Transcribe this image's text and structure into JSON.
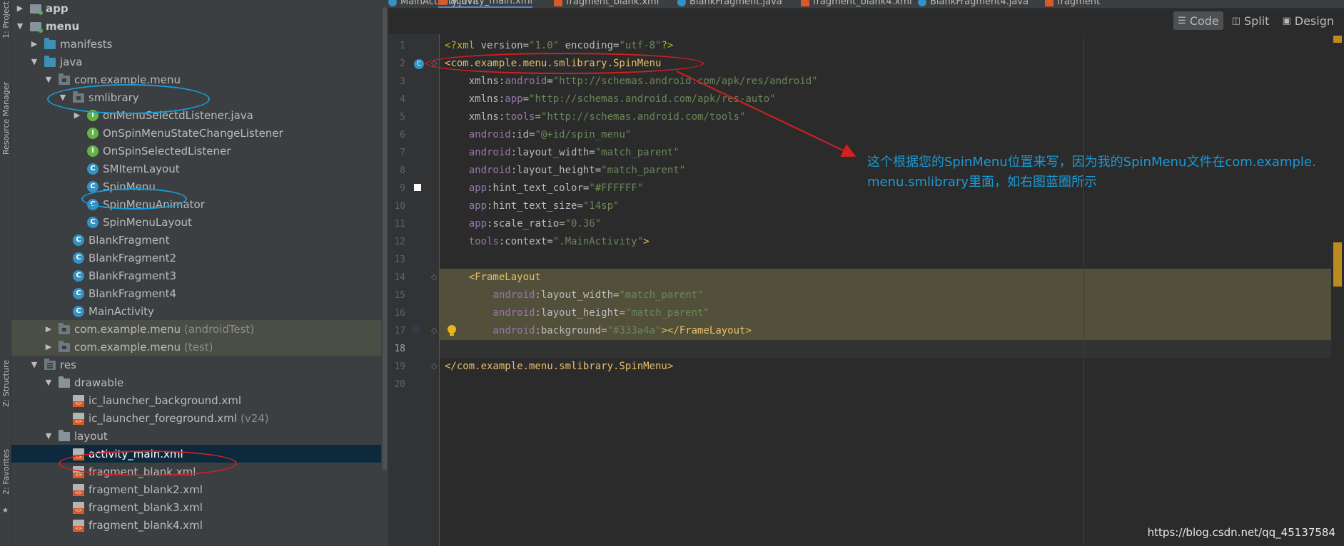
{
  "tool_strip": {
    "project_label": "1: Project",
    "resource_manager_label": "Resource Manager",
    "structure_label": "Z: Structure",
    "favorites_label": "2: Favorites"
  },
  "project_tree": {
    "items": [
      {
        "label": "app",
        "arrow": "▶",
        "icon": "module-folder-icon",
        "bold": true
      },
      {
        "label": "menu",
        "arrow": "▼",
        "icon": "module-folder-icon",
        "bold": true
      },
      {
        "label": "manifests",
        "arrow": "▶",
        "icon": "folder-icon"
      },
      {
        "label": "java",
        "arrow": "▼",
        "icon": "folder-icon"
      },
      {
        "label": "com.example.menu",
        "arrow": "▼",
        "icon": "package-icon"
      },
      {
        "label": "smlibrary",
        "arrow": "▼",
        "icon": "package-icon"
      },
      {
        "label": "onMenuSelectdListener.java",
        "arrow": "▶",
        "icon": "interface-icon",
        "glyph": "I"
      },
      {
        "label": "OnSpinMenuStateChangeListener",
        "icon": "interface-icon",
        "glyph": "I"
      },
      {
        "label": "OnSpinSelectedListener",
        "icon": "interface-icon",
        "glyph": "I"
      },
      {
        "label": "SMItemLayout",
        "icon": "class-icon",
        "glyph": "C"
      },
      {
        "label": "SpinMenu",
        "icon": "class-icon",
        "glyph": "C"
      },
      {
        "label": "SpinMenuAnimator",
        "icon": "class-icon",
        "glyph": "C"
      },
      {
        "label": "SpinMenuLayout",
        "icon": "class-icon",
        "glyph": "C"
      },
      {
        "label": "BlankFragment",
        "icon": "class-icon",
        "glyph": "C"
      },
      {
        "label": "BlankFragment2",
        "icon": "class-icon",
        "glyph": "C"
      },
      {
        "label": "BlankFragment3",
        "icon": "class-icon",
        "glyph": "C"
      },
      {
        "label": "BlankFragment4",
        "icon": "class-icon",
        "glyph": "C"
      },
      {
        "label": "MainActivity",
        "icon": "class-icon",
        "glyph": "C"
      },
      {
        "label": "com.example.menu",
        "suffix": "(androidTest)",
        "arrow": "▶",
        "icon": "package-icon"
      },
      {
        "label": "com.example.menu",
        "suffix": "(test)",
        "arrow": "▶",
        "icon": "package-icon"
      },
      {
        "label": "res",
        "arrow": "▼",
        "icon": "res-folder-icon"
      },
      {
        "label": "drawable",
        "arrow": "▼",
        "icon": "folder-icon"
      },
      {
        "label": "ic_launcher_background.xml",
        "icon": "xml-file-icon"
      },
      {
        "label": "ic_launcher_foreground.xml",
        "suffix": "(v24)",
        "icon": "xml-file-icon"
      },
      {
        "label": "layout",
        "arrow": "▼",
        "icon": "folder-icon"
      },
      {
        "label": "activity_main.xml",
        "icon": "xml-file-icon"
      },
      {
        "label": "fragment_blank.xml",
        "icon": "xml-file-icon"
      },
      {
        "label": "fragment_blank2.xml",
        "icon": "xml-file-icon"
      },
      {
        "label": "fragment_blank3.xml",
        "icon": "xml-file-icon"
      },
      {
        "label": "fragment_blank4.xml",
        "icon": "xml-file-icon"
      }
    ]
  },
  "editor_tabs": [
    {
      "label": "MainActivity.java",
      "icon": "java-class-icon"
    },
    {
      "label": "activity_main.xml",
      "icon": "xml-file-icon",
      "active": true
    },
    {
      "label": "fragment_blank.xml",
      "icon": "xml-file-icon"
    },
    {
      "label": "BlankFragment.java",
      "icon": "java-class-icon"
    },
    {
      "label": "fragment_blank4.xml",
      "icon": "xml-file-icon"
    },
    {
      "label": "BlankFragment4.java",
      "icon": "java-class-icon"
    },
    {
      "label": "fragment",
      "icon": "xml-file-icon"
    }
  ],
  "view_mode": {
    "code": "Code",
    "split": "Split",
    "design": "Design"
  },
  "code_lines": [
    [
      [
        "t-decl",
        "<?xml "
      ],
      [
        "t-attr",
        "version="
      ],
      [
        "t-val",
        "\"1.0\""
      ],
      [
        "t-attr",
        " encoding="
      ],
      [
        "t-val",
        "\"utf-8\""
      ],
      [
        "t-decl",
        "?>"
      ]
    ],
    [
      [
        "t-tag",
        "<com.example.menu.smlibrary.SpinMenu"
      ]
    ],
    [
      [
        "t-plain",
        "    "
      ],
      [
        "t-attr",
        "xmlns:"
      ],
      [
        "t-ns",
        "android"
      ],
      [
        "t-attr",
        "="
      ],
      [
        "t-val",
        "\"http://schemas.android.com/apk/res/android\""
      ]
    ],
    [
      [
        "t-plain",
        "    "
      ],
      [
        "t-attr",
        "xmlns:"
      ],
      [
        "t-ns",
        "app"
      ],
      [
        "t-attr",
        "="
      ],
      [
        "t-val",
        "\"http://schemas.android.com/apk/res-auto\""
      ]
    ],
    [
      [
        "t-plain",
        "    "
      ],
      [
        "t-attr",
        "xmlns:"
      ],
      [
        "t-ns",
        "tools"
      ],
      [
        "t-attr",
        "="
      ],
      [
        "t-val",
        "\"http://schemas.android.com/tools\""
      ]
    ],
    [
      [
        "t-plain",
        "    "
      ],
      [
        "t-ns",
        "android"
      ],
      [
        "t-attr",
        ":id="
      ],
      [
        "t-val",
        "\"@+id/spin_menu\""
      ]
    ],
    [
      [
        "t-plain",
        "    "
      ],
      [
        "t-ns",
        "android"
      ],
      [
        "t-attr",
        ":layout_width="
      ],
      [
        "t-val",
        "\"match_parent\""
      ]
    ],
    [
      [
        "t-plain",
        "    "
      ],
      [
        "t-ns",
        "android"
      ],
      [
        "t-attr",
        ":layout_height="
      ],
      [
        "t-val",
        "\"match_parent\""
      ]
    ],
    [
      [
        "t-plain",
        "    "
      ],
      [
        "t-ns",
        "app"
      ],
      [
        "t-attr",
        ":hint_text_color="
      ],
      [
        "t-val",
        "\"#FFFFFF\""
      ]
    ],
    [
      [
        "t-plain",
        "    "
      ],
      [
        "t-ns",
        "app"
      ],
      [
        "t-attr",
        ":hint_text_size="
      ],
      [
        "t-val",
        "\"14sp\""
      ]
    ],
    [
      [
        "t-plain",
        "    "
      ],
      [
        "t-ns",
        "app"
      ],
      [
        "t-attr",
        ":scale_ratio="
      ],
      [
        "t-val",
        "\"0.36\""
      ]
    ],
    [
      [
        "t-plain",
        "    "
      ],
      [
        "t-ns",
        "tools"
      ],
      [
        "t-attr",
        ":context="
      ],
      [
        "t-val",
        "\".MainActivity\""
      ],
      [
        "t-tag",
        ">"
      ]
    ],
    [],
    [
      [
        "t-plain",
        "    "
      ],
      [
        "t-tag",
        "<FrameLayout"
      ]
    ],
    [
      [
        "t-plain",
        "        "
      ],
      [
        "t-ns",
        "android"
      ],
      [
        "t-attr",
        ":layout_width="
      ],
      [
        "t-val",
        "\"match_parent\""
      ]
    ],
    [
      [
        "t-plain",
        "        "
      ],
      [
        "t-ns",
        "android"
      ],
      [
        "t-attr",
        ":layout_height="
      ],
      [
        "t-val",
        "\"match_parent\""
      ]
    ],
    [
      [
        "t-plain",
        "        "
      ],
      [
        "t-ns",
        "android"
      ],
      [
        "t-attr",
        ":background="
      ],
      [
        "t-val",
        "\"#333a4a\""
      ],
      [
        "t-tag",
        "></FrameLayout>"
      ]
    ],
    [],
    [
      [
        "t-tag",
        "</com.example.menu.smlibrary.SpinMenu>"
      ]
    ],
    []
  ],
  "line_numbers": [
    "1",
    "2",
    "3",
    "4",
    "5",
    "6",
    "7",
    "8",
    "9",
    "10",
    "11",
    "12",
    "13",
    "14",
    "15",
    "16",
    "17",
    "18",
    "19",
    "20"
  ],
  "annotation": {
    "text_line1": "这个根据您的SpinMenu位置来写，因为我的SpinMenu文件在com.example.",
    "text_line2": "menu.smlibrary里面，如右图蓝圈所示",
    "color": "#1a9ad6",
    "arrow_color": "#d32020"
  },
  "watermark": "https://blog.csdn.net/qq_45137584",
  "colors": {
    "background": "#2b2b2b",
    "panel": "#3c3f41",
    "selection": "#0d293e",
    "highlight": "#52503a"
  }
}
